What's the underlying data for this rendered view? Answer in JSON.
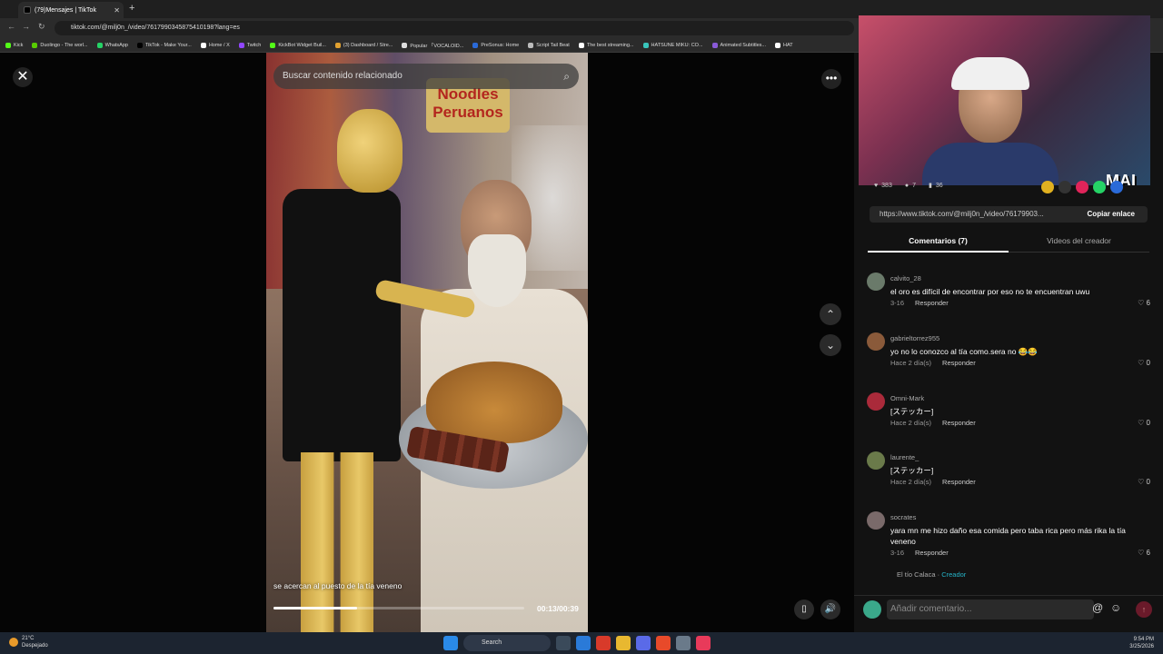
{
  "browser": {
    "tab_title": "(79)Mensajes | TikTok",
    "url": "tiktok.com/@milj0n_/video/7617990345875410198?lang=es",
    "bookmarks": [
      {
        "label": "Kick",
        "color": "#53fc18"
      },
      {
        "label": "Duolingo - The worl...",
        "color": "#58cc02"
      },
      {
        "label": "WhatsApp",
        "color": "#25d366"
      },
      {
        "label": "TikTok - Make Your...",
        "color": "#000000"
      },
      {
        "label": "Home / X",
        "color": "#ffffff"
      },
      {
        "label": "Twitch",
        "color": "#9146ff"
      },
      {
        "label": "KickBot Widget Buil...",
        "color": "#53fc18"
      },
      {
        "label": "(3) Dashboard / Stre...",
        "color": "#e0a030"
      },
      {
        "label": "Popular 「VOCALOID...",
        "color": "#dddddd"
      },
      {
        "label": "PreSonus: Home",
        "color": "#2a6ad8"
      },
      {
        "label": "Script Tail Beat",
        "color": "#bbbbbb"
      },
      {
        "label": "The best streaming...",
        "color": "#ffffff"
      },
      {
        "label": "HATSUNE MIKU: CO...",
        "color": "#39c5bb"
      },
      {
        "label": "Animated Subtitles...",
        "color": "#8a5ad8"
      },
      {
        "label": "HAT",
        "color": "#ffffff"
      }
    ]
  },
  "video": {
    "search_placeholder": "Buscar contenido relacionado",
    "sign_text": "Noodles Peruanos",
    "caption": "se acercan al puesto de la tía veneno",
    "time": "00:13/00:39",
    "progress_fraction": 0.333
  },
  "webcam": {
    "overlay_text": "MAI"
  },
  "stats": {
    "likes": "383",
    "comments": "7",
    "saves": "36"
  },
  "share": {
    "link": "https://www.tiktok.com/@milj0n_/video/76179903...",
    "copy_label": "Copiar enlace"
  },
  "tabs": {
    "comments": "Comentarios (7)",
    "creator_videos": "Videos del creador"
  },
  "comments": [
    {
      "user": "calvito_28",
      "text": "el oro es difícil de encontrar por eso no te encuentran uwu",
      "date": "3-16",
      "reply": "Responder",
      "likes": "6",
      "avatar_color": "#6a7a6a"
    },
    {
      "user": "gabrieltorrez955",
      "text": "yo no lo conozco al tía como.sera no 😂😂",
      "date": "Hace 2 día(s)",
      "reply": "Responder",
      "likes": "0",
      "avatar_color": "#8a5a3a"
    },
    {
      "user": "Omni-Mark",
      "text": "[ステッカー]",
      "date": "Hace 2 día(s)",
      "reply": "Responder",
      "likes": "0",
      "avatar_color": "#aa2a3a"
    },
    {
      "user": "laurente_",
      "text": "[ステッカー]",
      "date": "Hace 2 día(s)",
      "reply": "Responder",
      "likes": "0",
      "avatar_color": "#6a7a4a"
    },
    {
      "user": "socrates",
      "text": "yara mn me hizo daño esa comida pero taba rica pero más rika la tía veneno",
      "date": "3-16",
      "reply": "Responder",
      "likes": "6",
      "avatar_color": "#7a6a6a"
    }
  ],
  "reply_preview": {
    "user": "El tío Calaca",
    "separator": " · ",
    "badge": "Creador"
  },
  "add_comment": {
    "placeholder": "Añadir comentario..."
  },
  "taskbar": {
    "temp": "21°C",
    "condition": "Despejado",
    "search": "Search",
    "time": "9:54 PM",
    "date": "3/25/2026"
  }
}
